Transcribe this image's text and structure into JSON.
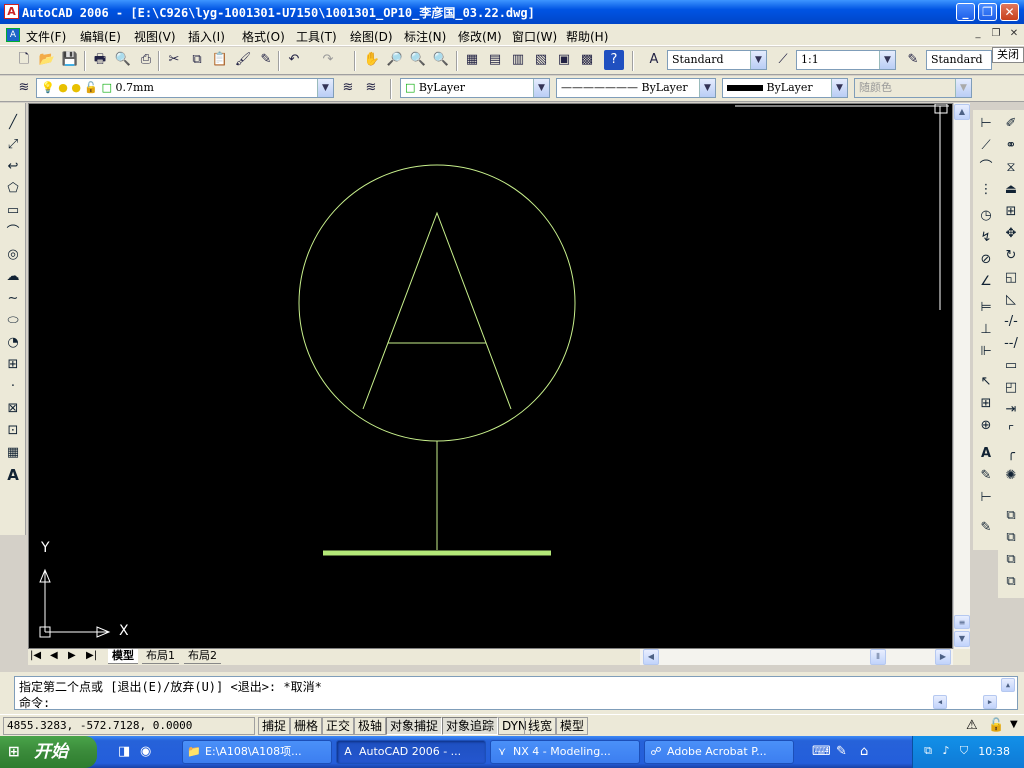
{
  "window": {
    "title": "AutoCAD 2006 - [E:\\C926\\lyg-1001301-U7150\\1001301_OP10_李彦国_03.22.dwg]"
  },
  "menu": [
    "文件(F)",
    "编辑(E)",
    "视图(V)",
    "插入(I)",
    "格式(O)",
    "工具(T)",
    "绘图(D)",
    "标注(N)",
    "修改(M)",
    "窗口(W)",
    "帮助(H)"
  ],
  "toolbar": {
    "text_style": "Standard",
    "dim_scale": "1:1",
    "table_style": "Standard",
    "close_label": "关闭"
  },
  "layers": {
    "current_layer": "0.7mm",
    "color": "ByLayer",
    "linetype": "ByLayer",
    "lineweight": "ByLayer",
    "plotstyle": "随颜色"
  },
  "drawing": {
    "ucs_y": "Y",
    "ucs_x": "X",
    "circle_label": "A",
    "colors": {
      "entity": "#c8f08c",
      "thick": "#b4e878",
      "background": "#000000"
    }
  },
  "tabs": [
    "模型",
    "布局1",
    "布局2"
  ],
  "command": {
    "line1": "指定第二个点或 [退出(E)/放弃(U)] <退出>:  *取消*",
    "line2": "命令:"
  },
  "status": {
    "coords": "4855.3283, -572.7128, 0.0000",
    "toggles": [
      "捕捉",
      "栅格",
      "正交",
      "极轴",
      "对象捕捉",
      "对象追踪",
      "DYN",
      "线宽",
      "模型"
    ]
  },
  "taskbar": {
    "start": "开始",
    "tasks": [
      "E:\\A108\\A108项...",
      "AutoCAD 2006 - ...",
      "NX 4 - Modeling...",
      "Adobe Acrobat P..."
    ],
    "clock": "10:38"
  }
}
